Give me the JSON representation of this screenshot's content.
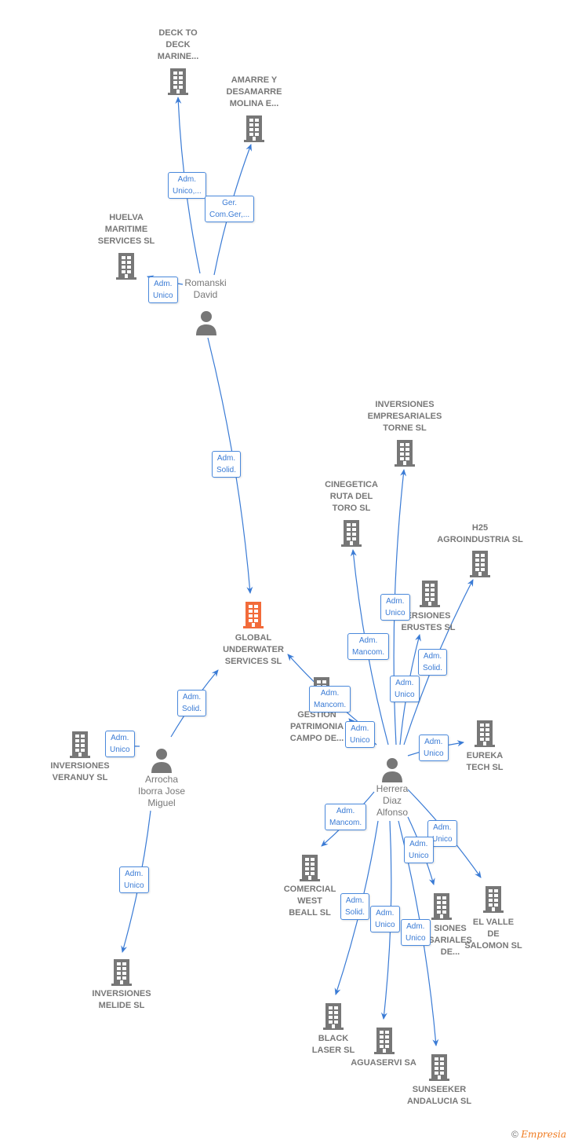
{
  "nodes": [
    {
      "id": "deck",
      "type": "company",
      "label": "DECK TO\nDECK\nMARINE..."
    },
    {
      "id": "amarre",
      "type": "company",
      "label": "AMARRE Y\nDESAMARRE\nMOLINA E..."
    },
    {
      "id": "huelva",
      "type": "company",
      "label": "HUELVA\nMARITIME\nSERVICES  SL"
    },
    {
      "id": "romanski",
      "type": "person",
      "label": "Romanski\nDavid"
    },
    {
      "id": "global",
      "type": "focus",
      "label": "GLOBAL\nUNDERWATER\nSERVICES  SL"
    },
    {
      "id": "torne",
      "type": "company",
      "label": "INVERSIONES\nEMPRESARIALES\nTORNE SL"
    },
    {
      "id": "cinegetica",
      "type": "company",
      "label": "CINEGETICA\nRUTA DEL\nTORO  SL"
    },
    {
      "id": "h25",
      "type": "company",
      "label": "H25\nAGROINDUSTRIA SL"
    },
    {
      "id": "erustes",
      "type": "company",
      "label": "ERSIONES\nERUSTES SL"
    },
    {
      "id": "gestion",
      "type": "company",
      "label": "GESTION\nPATRIMONIA\nCAMPO DE..."
    },
    {
      "id": "eureka",
      "type": "company",
      "label": "EUREKA\nTECH  SL"
    },
    {
      "id": "herrera",
      "type": "person",
      "label": "Herrera\nDiaz\nAlfonso"
    },
    {
      "id": "arrocha",
      "type": "person",
      "label": "Arrocha\nIborra Jose\nMiguel"
    },
    {
      "id": "veranuy",
      "type": "company",
      "label": "INVERSIONES\nVERANUY  SL"
    },
    {
      "id": "comercial",
      "type": "company",
      "label": "COMERCIAL\nWEST\nBEALL  SL"
    },
    {
      "id": "valle",
      "type": "company",
      "label": "EL VALLE\nDE\nSALOMON  SL"
    },
    {
      "id": "invde",
      "type": "company",
      "label": "SIONES\nSARIALES\nDE..."
    },
    {
      "id": "black",
      "type": "company",
      "label": "BLACK\nLASER  SL"
    },
    {
      "id": "aguaservi",
      "type": "company",
      "label": "AGUASERVI SA"
    },
    {
      "id": "sunseeker",
      "type": "company",
      "label": "SUNSEEKER\nANDALUCIA  SL"
    },
    {
      "id": "melide",
      "type": "company",
      "label": "INVERSIONES\nMELIDE  SL"
    }
  ],
  "edges": [
    {
      "from": "romanski",
      "to": "deck",
      "label": "Adm.\nUnico,..."
    },
    {
      "from": "romanski",
      "to": "amarre",
      "label": "Ger.\nCom.Ger,..."
    },
    {
      "from": "romanski",
      "to": "huelva",
      "label": "Adm.\nUnico"
    },
    {
      "from": "romanski",
      "to": "global",
      "label": "Adm.\nSolid."
    },
    {
      "from": "arrocha",
      "to": "global",
      "label": "Adm.\nSolid."
    },
    {
      "from": "arrocha",
      "to": "veranuy",
      "label": "Adm.\nUnico"
    },
    {
      "from": "arrocha",
      "to": "melide",
      "label": "Adm.\nUnico"
    },
    {
      "from": "herrera",
      "to": "torne",
      "label": "Adm.\nUnico"
    },
    {
      "from": "herrera",
      "to": "cinegetica",
      "label": "Adm.\nMancom."
    },
    {
      "from": "herrera",
      "to": "erustes",
      "label": "Adm.\nUnico"
    },
    {
      "from": "herrera",
      "to": "h25",
      "label": "Adm.\nSolid."
    },
    {
      "from": "herrera",
      "to": "global",
      "label": "Adm.\nMancom."
    },
    {
      "from": "herrera",
      "to": "gestion",
      "label": "Adm.\nUnico"
    },
    {
      "from": "herrera",
      "to": "eureka",
      "label": "Adm.\nUnico"
    },
    {
      "from": "herrera",
      "to": "comercial",
      "label": "Adm.\nMancom."
    },
    {
      "from": "herrera",
      "to": "valle",
      "label": "Adm.\nUnico"
    },
    {
      "from": "herrera",
      "to": "invde",
      "label": "Adm.\nUnico"
    },
    {
      "from": "herrera",
      "to": "black",
      "label": "Adm.\nSolid."
    },
    {
      "from": "herrera",
      "to": "aguaservi",
      "label": "Adm.\nUnico"
    },
    {
      "from": "herrera",
      "to": "sunseeker",
      "label": "Adm.\nUnico"
    }
  ],
  "colors": {
    "edge": "#3a7bd5",
    "company": "#777777",
    "focus": "#f26b3a",
    "person": "#777777"
  },
  "footer": {
    "copyright": "©",
    "brand": "Empresia"
  }
}
